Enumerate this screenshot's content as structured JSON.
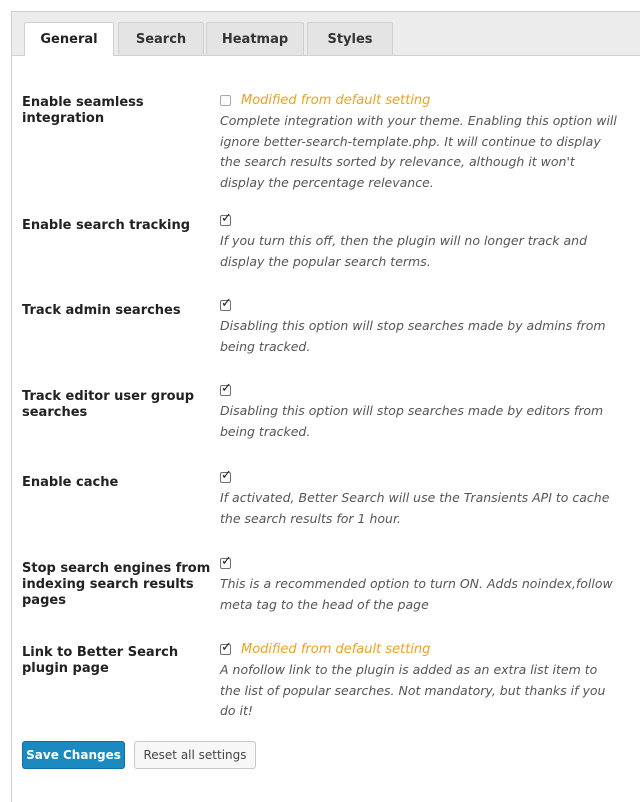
{
  "tabs": [
    {
      "label": "General"
    },
    {
      "label": "Search"
    },
    {
      "label": "Heatmap"
    },
    {
      "label": "Styles"
    }
  ],
  "settings": [
    {
      "label": "Enable seamless integration",
      "checked": false,
      "modified": "Modified from default setting",
      "description": "Complete integration with your theme. Enabling this option will ignore better-search-template.php. It will continue to display the search results sorted by relevance, although it won't display the percentage relevance."
    },
    {
      "label": "Enable search tracking",
      "checked": true,
      "modified": "",
      "description": "If you turn this off, then the plugin will no longer track and display the popular search terms."
    },
    {
      "label": "Track admin searches",
      "checked": true,
      "modified": "",
      "description": "Disabling this option will stop searches made by admins from being tracked."
    },
    {
      "label": "Track editor user group searches",
      "checked": true,
      "modified": "",
      "description": "Disabling this option will stop searches made by editors from being tracked."
    },
    {
      "label": "Enable cache",
      "checked": true,
      "modified": "",
      "description": "If activated, Better Search will use the Transients API to cache the search results for 1 hour."
    },
    {
      "label": "Stop search engines from indexing search results pages",
      "checked": true,
      "modified": "",
      "description": "This is a recommended option to turn ON. Adds noindex,follow meta tag to the head of the page"
    },
    {
      "label": "Link to Better Search plugin page",
      "checked": true,
      "modified": "Modified from default setting",
      "description": "A nofollow link to the plugin is added as an extra list item to the list of popular searches. Not mandatory, but thanks if you do it!"
    }
  ],
  "buttons": {
    "save": "Save Changes",
    "reset": "Reset all settings"
  },
  "colors": {
    "modified": "#f0a020",
    "primary": "#1a8ac0"
  }
}
